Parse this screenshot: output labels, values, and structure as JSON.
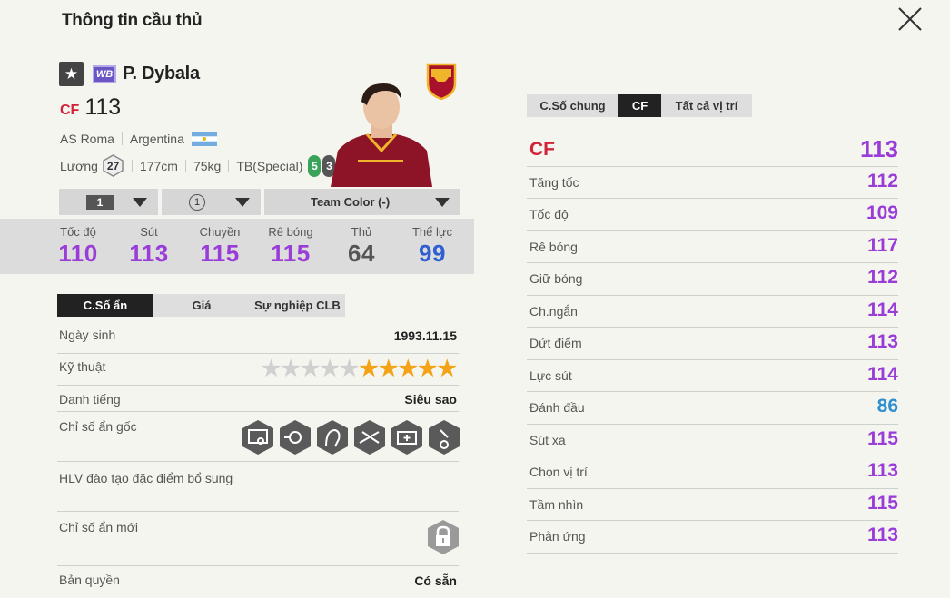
{
  "title": "Thông tin cầu thủ",
  "player": {
    "season_badge": "WB",
    "name": "P. Dybala",
    "position": "CF",
    "ovr": "113",
    "club": "AS Roma",
    "nation": "Argentina",
    "wage_label": "Lương",
    "wage": "27",
    "height": "177cm",
    "weight": "75kg",
    "body_type": "TB(Special)",
    "weak_foot_left": "5",
    "weak_foot_right": "3"
  },
  "selectors": {
    "level": "1",
    "rank": "1",
    "team_color": "Team Color (-)"
  },
  "stats": [
    {
      "label": "Tốc độ",
      "value": "110",
      "color": "#9a3cd8"
    },
    {
      "label": "Sút",
      "value": "113",
      "color": "#9a3cd8"
    },
    {
      "label": "Chuyền",
      "value": "115",
      "color": "#9a3cd8"
    },
    {
      "label": "Rê bóng",
      "value": "115",
      "color": "#9a3cd8"
    },
    {
      "label": "Thủ",
      "value": "64",
      "color": "#555555"
    },
    {
      "label": "Thể lực",
      "value": "99",
      "color": "#2f5fd0"
    }
  ],
  "left_tabs": [
    "C.Số ẩn",
    "Giá",
    "Sự nghiệp CLB"
  ],
  "details": {
    "birthday_label": "Ngày sinh",
    "birthday": "1993.11.15",
    "skill_label": "Kỹ thuật",
    "skill_stars": 5,
    "reputation_label": "Danh tiếng",
    "reputation": "Siêu sao",
    "hidden_traits_label": "Chỉ số ẩn gốc",
    "coach_label": "HLV đào tạo đặc điểm bổ sung",
    "new_traits_label": "Chỉ số ẩn mới",
    "license_label": "Bản quyền",
    "license": "Có sẵn"
  },
  "right_tabs": [
    "C.Số chung",
    "CF",
    "Tất cả vị trí"
  ],
  "attributes": {
    "header": {
      "label": "CF",
      "value": "113"
    },
    "rows": [
      {
        "label": "Tăng tốc",
        "value": "112",
        "color": "purple"
      },
      {
        "label": "Tốc độ",
        "value": "109",
        "color": "purple"
      },
      {
        "label": "Rê bóng",
        "value": "117",
        "color": "purple"
      },
      {
        "label": "Giữ bóng",
        "value": "112",
        "color": "purple"
      },
      {
        "label": "Ch.ngắn",
        "value": "114",
        "color": "purple"
      },
      {
        "label": "Dứt điểm",
        "value": "113",
        "color": "purple"
      },
      {
        "label": "Lực sút",
        "value": "114",
        "color": "purple"
      },
      {
        "label": "Đánh đầu",
        "value": "86",
        "color": "blue"
      },
      {
        "label": "Sút xa",
        "value": "115",
        "color": "purple"
      },
      {
        "label": "Chọn vị trí",
        "value": "113",
        "color": "purple"
      },
      {
        "label": "Tầm nhìn",
        "value": "115",
        "color": "purple"
      },
      {
        "label": "Phản ứng",
        "value": "113",
        "color": "purple"
      }
    ]
  },
  "colors": {
    "accent_red": "#d12238",
    "purple": "#9a3cd8",
    "blue": "#2f8fd0"
  }
}
